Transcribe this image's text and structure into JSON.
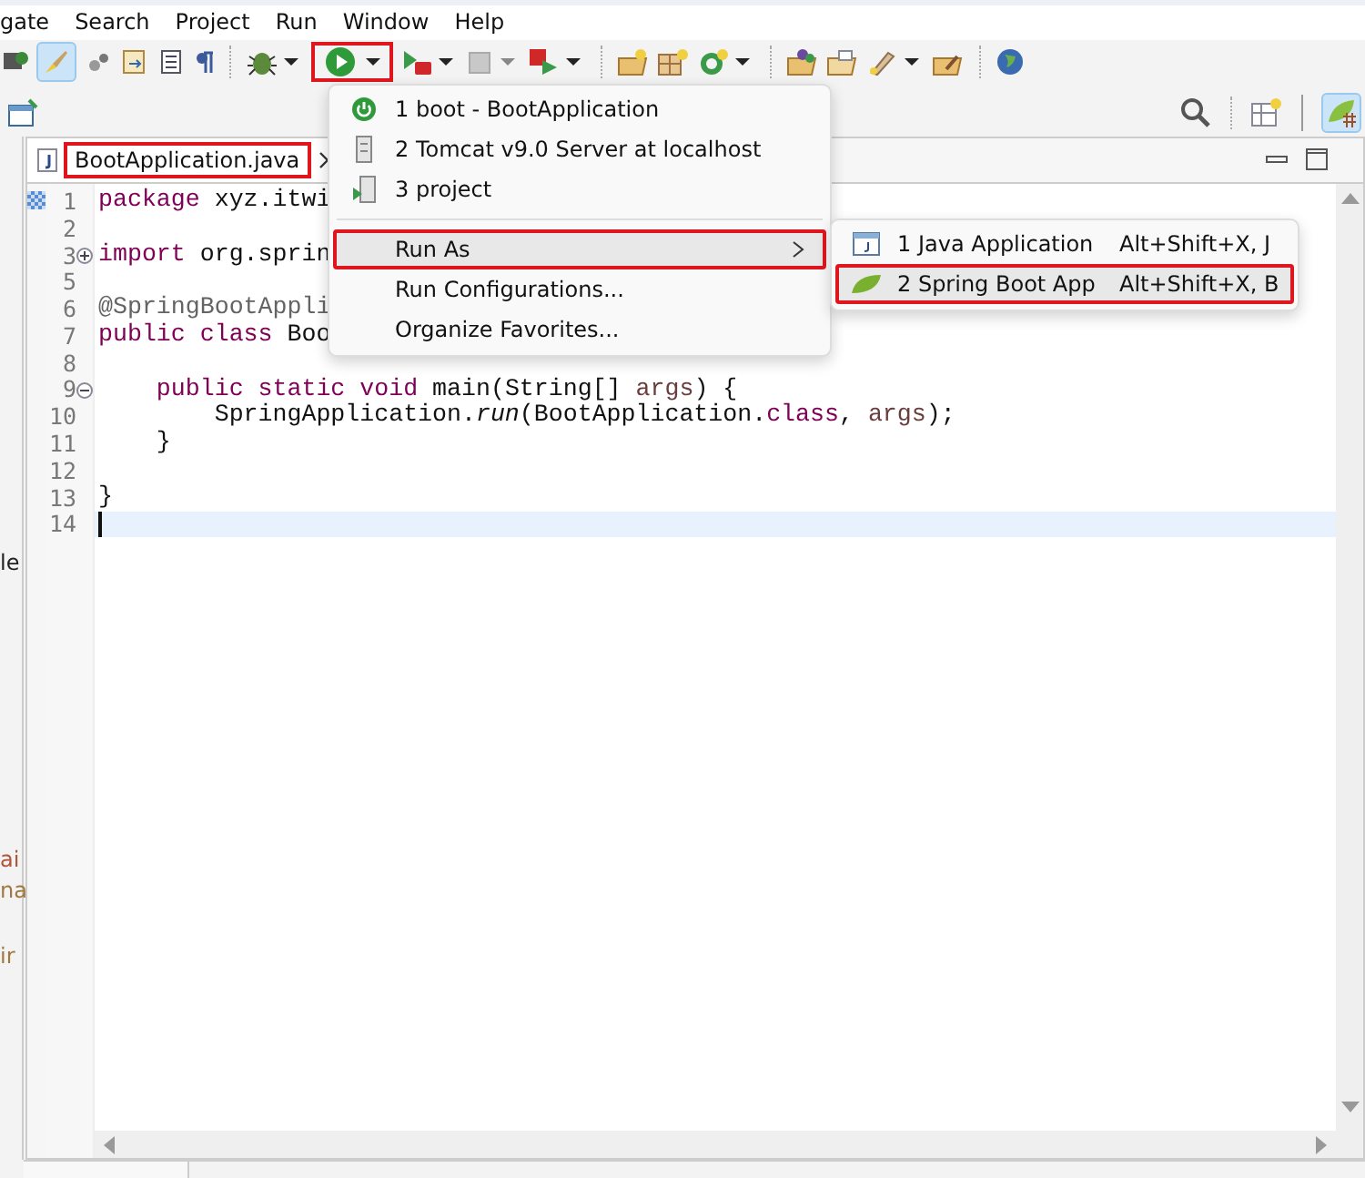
{
  "menu_bar": [
    "gate",
    "Search",
    "Project",
    "Run",
    "Window",
    "Help"
  ],
  "toolbar": {
    "run_button": {
      "highlighted": true
    }
  },
  "left_panel_fragments": [
    {
      "text": "le",
      "kind": "dark"
    },
    {
      "text": "ai",
      "kind": "red"
    },
    {
      "text": "na",
      "kind": "brown"
    },
    {
      "text": "ir",
      "kind": "brown"
    }
  ],
  "editor": {
    "tab": {
      "label": "BootApplication.java",
      "highlighted": true
    },
    "lines": [
      {
        "number": "1",
        "segments": [
          {
            "kind": "keyword",
            "text": "package"
          },
          {
            "kind": "plain",
            "text": " xyz.itwi"
          }
        ]
      },
      {
        "number": "2"
      },
      {
        "number": "3",
        "collapsed": true,
        "segments": [
          {
            "kind": "keyword",
            "text": "import"
          },
          {
            "kind": "plain",
            "text": " org.sprin"
          }
        ]
      },
      {
        "number": "5"
      },
      {
        "number": "6",
        "segments": [
          {
            "kind": "annotation",
            "text": "@SpringBootAppli"
          }
        ]
      },
      {
        "number": "7",
        "segments": [
          {
            "kind": "keyword",
            "text": "public class"
          },
          {
            "kind": "plain",
            "text": " Boo"
          }
        ]
      },
      {
        "number": "8"
      },
      {
        "number": "9",
        "collapsed": false,
        "segments": [
          {
            "kind": "keyword",
            "text": "    public static void"
          },
          {
            "kind": "plain",
            "text": " main(String[] "
          },
          {
            "kind": "param",
            "text": "args"
          },
          {
            "kind": "plain",
            "text": ") {"
          }
        ]
      },
      {
        "number": "10",
        "segments": [
          {
            "kind": "plain",
            "text": "        SpringApplication."
          },
          {
            "kind": "method",
            "text": "run"
          },
          {
            "kind": "plain",
            "text": "(BootApplication."
          },
          {
            "kind": "keyword",
            "text": "class"
          },
          {
            "kind": "plain",
            "text": ", "
          },
          {
            "kind": "param",
            "text": "args"
          },
          {
            "kind": "plain",
            "text": ");"
          }
        ]
      },
      {
        "number": "11",
        "segments": [
          {
            "kind": "plain",
            "text": "    }"
          }
        ]
      },
      {
        "number": "12"
      },
      {
        "number": "13",
        "segments": [
          {
            "kind": "plain",
            "text": "}"
          }
        ]
      },
      {
        "number": "14",
        "current": true
      }
    ]
  },
  "run_menu": {
    "items": [
      {
        "kind": "boot",
        "label": "1 boot - BootApplication"
      },
      {
        "kind": "server",
        "label": "2 Tomcat v9.0 Server at localhost"
      },
      {
        "kind": "project",
        "label": "3 project"
      },
      {
        "kind": "separator"
      },
      {
        "kind": "submenu",
        "label": "Run As",
        "selected": true,
        "highlighted": true
      },
      {
        "kind": "plain",
        "label": "Run Configurations..."
      },
      {
        "kind": "plain",
        "label": "Organize Favorites..."
      }
    ]
  },
  "run_as_submenu": [
    {
      "kind": "java",
      "label": "1 Java Application",
      "shortcut": "Alt+Shift+X, J",
      "selected": false,
      "highlighted": false
    },
    {
      "kind": "spring",
      "label": "2 Spring Boot App",
      "shortcut": "Alt+Shift+X, B",
      "selected": true,
      "highlighted": true
    }
  ]
}
